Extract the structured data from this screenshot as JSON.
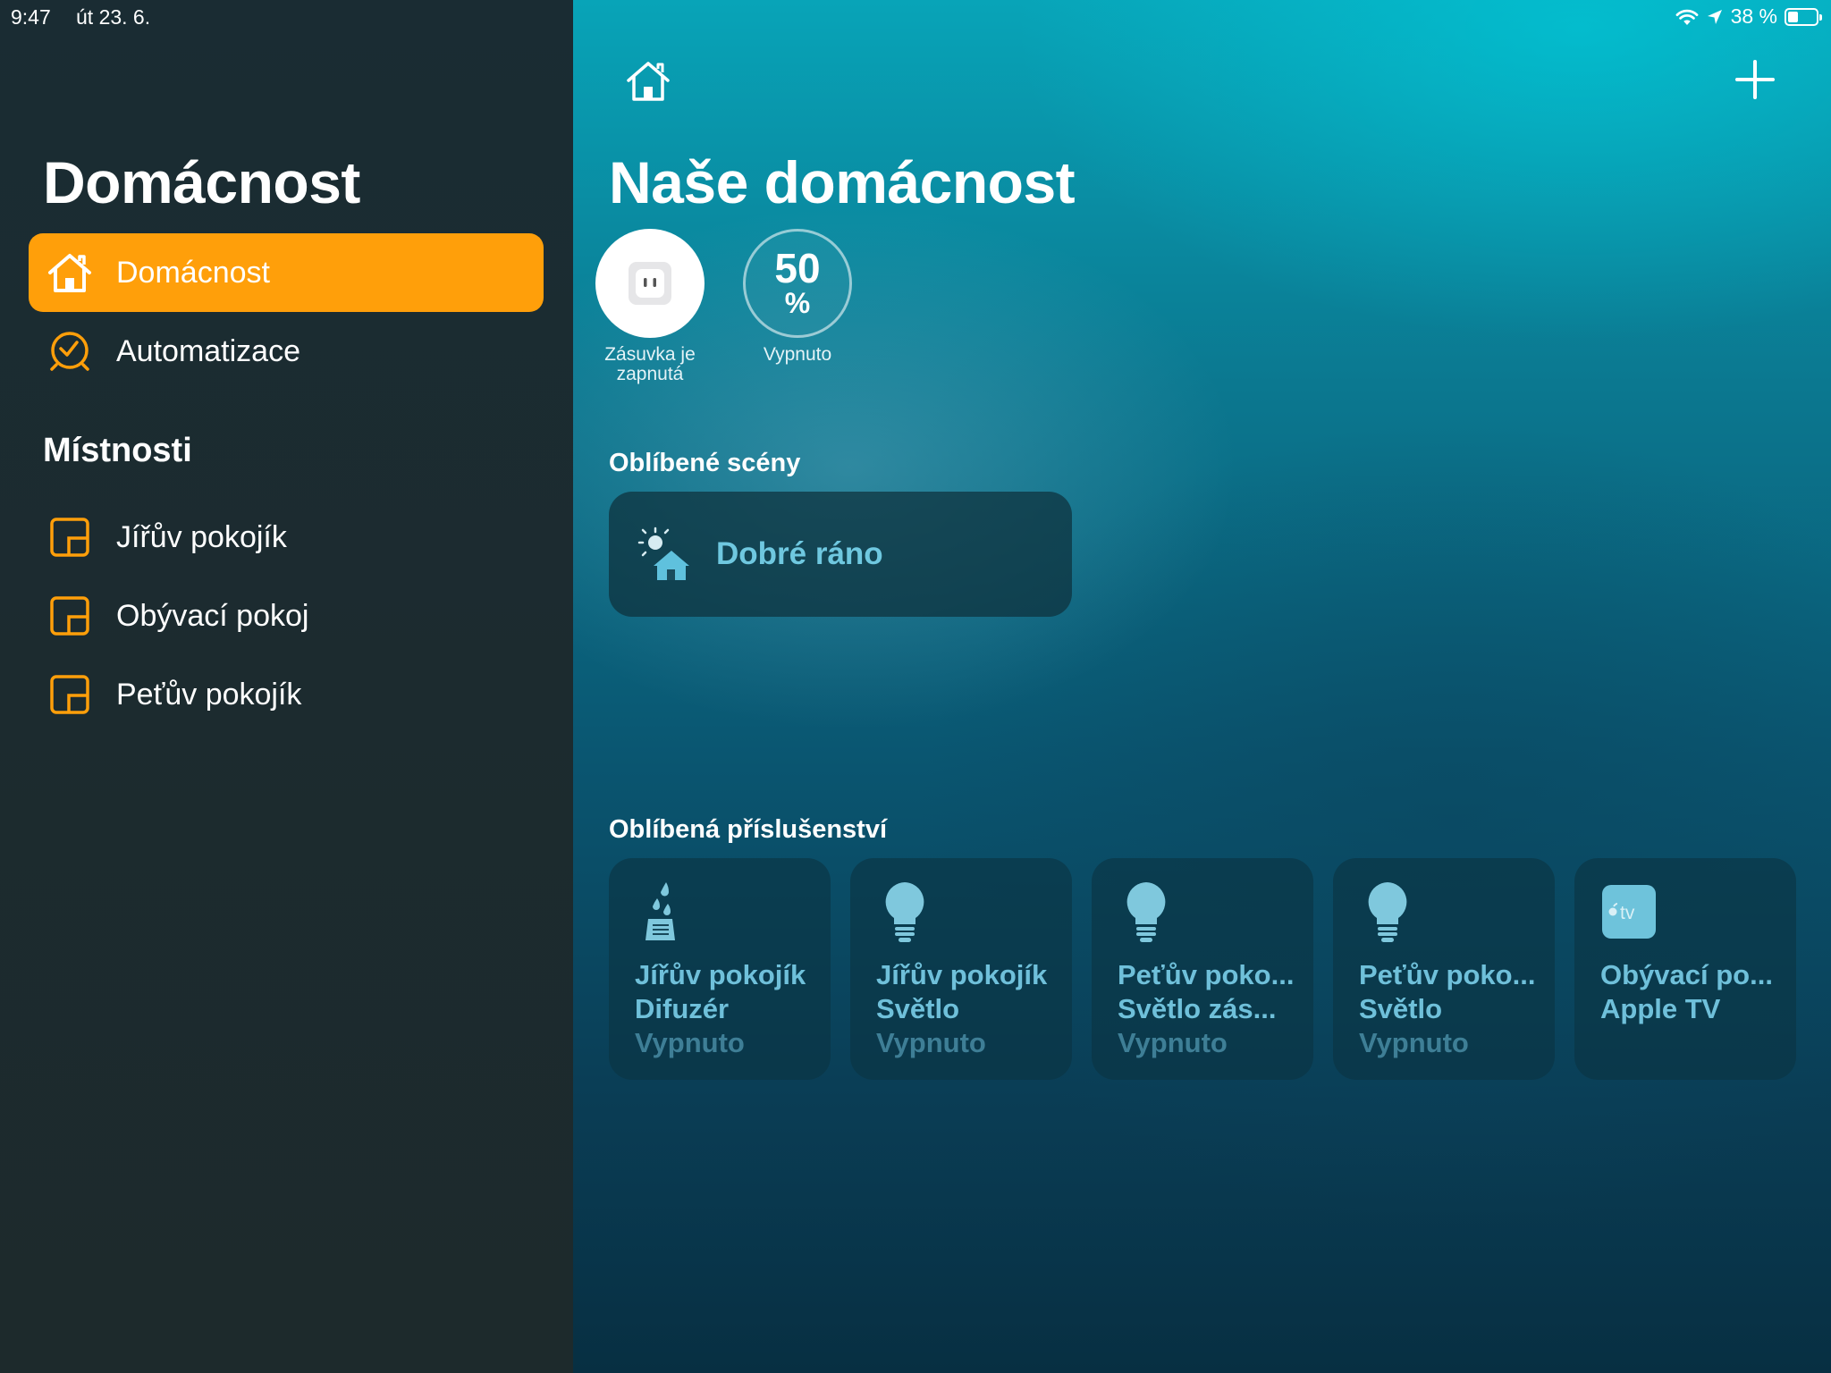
{
  "status_bar": {
    "time": "9:47",
    "date": "út 23. 6.",
    "battery_label": "38 %",
    "battery_level": 0.38
  },
  "sidebar": {
    "title": "Domácnost",
    "nav": [
      {
        "label": "Domácnost",
        "icon": "home-icon",
        "active": true
      },
      {
        "label": "Automatizace",
        "icon": "clock-icon",
        "active": false
      }
    ],
    "rooms_title": "Místnosti",
    "rooms": [
      {
        "label": "Jířův pokojík",
        "icon": "room-icon"
      },
      {
        "label": "Obývací pokoj",
        "icon": "room-icon"
      },
      {
        "label": "Peťův pokojík",
        "icon": "room-icon"
      }
    ]
  },
  "main": {
    "title": "Naše domácnost",
    "status_tiles": [
      {
        "icon": "outlet-icon",
        "caption_1": "Zásuvka je",
        "caption_2": "zapnutá"
      },
      {
        "value": "50",
        "unit": "%",
        "caption_1": "Vypnuto"
      }
    ],
    "scenes_title": "Oblíbené scény",
    "scenes": [
      {
        "label": "Dobré ráno",
        "icon": "morning-scene-icon"
      }
    ],
    "accessories_title": "Oblíbená příslušenství",
    "accessories": [
      {
        "line1": "Jířův pokojík",
        "line2": "Difuzér",
        "line3": "Vypnuto",
        "icon": "diffuser-icon"
      },
      {
        "line1": "Jířův pokojík",
        "line2": "Světlo",
        "line3": "Vypnuto",
        "icon": "lightbulb-icon"
      },
      {
        "line1": "Peťův poko...",
        "line2": "Světlo zás...",
        "line3": "Vypnuto",
        "icon": "lightbulb-icon"
      },
      {
        "line1": "Peťův poko...",
        "line2": "Světlo",
        "line3": "Vypnuto",
        "icon": "lightbulb-icon"
      },
      {
        "line1": "Obývací po...",
        "line2": "Apple TV",
        "icon": "apple-tv-icon",
        "icon_text": "tv"
      }
    ]
  },
  "colors": {
    "accent": "#ff9f0a",
    "sidebar_bg": "#1c2b2f",
    "tile_text": "#6fc0da"
  }
}
